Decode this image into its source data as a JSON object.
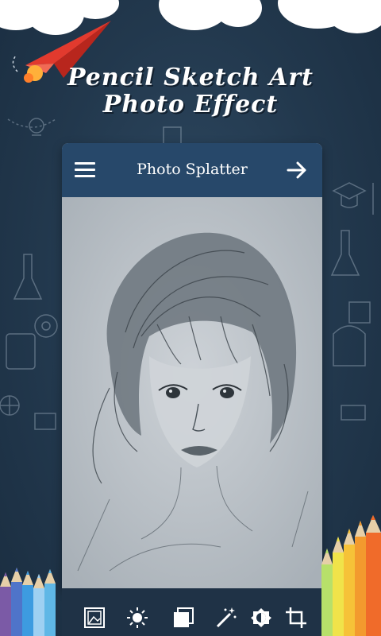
{
  "promo": {
    "title_line1": "Pencil Sketch Art",
    "title_line2": "Photo Effect"
  },
  "app": {
    "title": "Photo Splatter",
    "menu_icon": "hamburger-menu-icon",
    "next_icon": "arrow-right-icon"
  },
  "toolbar": {
    "items": [
      {
        "icon": "image-gallery-icon"
      },
      {
        "icon": "brightness-icon"
      },
      {
        "icon": "layers-icon"
      },
      {
        "icon": "magic-wand-icon"
      },
      {
        "icon": "contrast-icon"
      },
      {
        "icon": "crop-icon"
      }
    ]
  },
  "colors": {
    "appbar": "#27486a",
    "background": "#22384d",
    "toolbar": "#1f3246"
  }
}
